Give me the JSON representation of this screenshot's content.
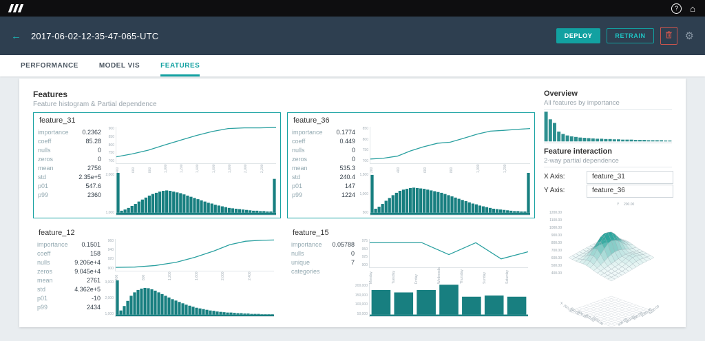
{
  "colors": {
    "accent": "#12a1a1",
    "hist": "#187f80",
    "line": "#2aa0a0",
    "navy": "#2e3f50",
    "topbar": "#0e0e10",
    "danger": "#c9544d"
  },
  "topbar": {
    "help_glyph": "?",
    "home_glyph": "⌂"
  },
  "navbar": {
    "back_glyph": "←",
    "title": "2017-06-02-12-35-47-065-UTC",
    "deploy": "DEPLOY",
    "retrain": "RETRAIN",
    "gear_glyph": "⚙"
  },
  "tabs": [
    {
      "label": "PERFORMANCE",
      "active": false
    },
    {
      "label": "MODEL VIS",
      "active": false
    },
    {
      "label": "FEATURES",
      "active": true
    }
  ],
  "features_section": {
    "title": "Features",
    "subtitle": "Feature histogram & Partial dependence",
    "panels": [
      {
        "name": "feature_31",
        "bordered": true,
        "type": "numeric",
        "stats": [
          {
            "label": "importance",
            "value": "0.2362"
          },
          {
            "label": "coeff",
            "value": "85.28"
          },
          {
            "label": "nulls",
            "value": "0"
          },
          {
            "label": "zeros",
            "value": "0"
          },
          {
            "label": "mean",
            "value": "2756"
          },
          {
            "label": "std",
            "value": "2.35e+5"
          },
          {
            "label": "p01",
            "value": "547.6"
          },
          {
            "label": "p99",
            "value": "2360"
          }
        ],
        "line": {
          "y_ticks": [
            "900",
            "850",
            "800",
            "750",
            "700"
          ],
          "points": [
            [
              0,
              0.18
            ],
            [
              0.1,
              0.26
            ],
            [
              0.2,
              0.36
            ],
            [
              0.3,
              0.5
            ],
            [
              0.4,
              0.63
            ],
            [
              0.5,
              0.76
            ],
            [
              0.6,
              0.87
            ],
            [
              0.7,
              0.95
            ],
            [
              0.8,
              0.97
            ],
            [
              0.9,
              0.97
            ],
            [
              1,
              0.98
            ]
          ]
        },
        "x_ticks": [
          "400",
          "600",
          "800",
          "1,000",
          "1,200",
          "1,400",
          "1,600",
          "1,800",
          "2,000",
          "2,200"
        ],
        "hist": {
          "y_ticks": [
            "2,000",
            "1,000"
          ],
          "values": [
            1,
            0.05,
            0.08,
            0.12,
            0.17,
            0.22,
            0.28,
            0.33,
            0.38,
            0.43,
            0.47,
            0.5,
            0.53,
            0.55,
            0.56,
            0.55,
            0.53,
            0.51,
            0.49,
            0.46,
            0.43,
            0.4,
            0.37,
            0.34,
            0.31,
            0.28,
            0.25,
            0.23,
            0.2,
            0.18,
            0.16,
            0.14,
            0.12,
            0.11,
            0.1,
            0.09,
            0.08,
            0.07,
            0.06,
            0.05,
            0.05,
            0.04,
            0.04,
            0.03,
            0.03,
            0.85
          ]
        }
      },
      {
        "name": "feature_36",
        "bordered": true,
        "type": "numeric",
        "stats": [
          {
            "label": "importance",
            "value": "0.1774"
          },
          {
            "label": "coeff",
            "value": "0.449"
          },
          {
            "label": "nulls",
            "value": "0"
          },
          {
            "label": "zeros",
            "value": "0"
          },
          {
            "label": "mean",
            "value": "535.3"
          },
          {
            "label": "std",
            "value": "240.4"
          },
          {
            "label": "p01",
            "value": "147"
          },
          {
            "label": "p99",
            "value": "1224"
          }
        ],
        "line": {
          "y_ticks": [
            "850",
            "800",
            "750",
            "700"
          ],
          "points": [
            [
              0,
              0.12
            ],
            [
              0.08,
              0.14
            ],
            [
              0.17,
              0.2
            ],
            [
              0.25,
              0.34
            ],
            [
              0.33,
              0.45
            ],
            [
              0.42,
              0.55
            ],
            [
              0.5,
              0.58
            ],
            [
              0.58,
              0.68
            ],
            [
              0.67,
              0.8
            ],
            [
              0.75,
              0.88
            ],
            [
              0.83,
              0.9
            ],
            [
              0.92,
              0.93
            ],
            [
              1,
              0.95
            ]
          ]
        },
        "x_ticks": [
          "200",
          "400",
          "600",
          "800",
          "1,000",
          "1,200"
        ],
        "hist": {
          "y_ticks": [
            "1,500",
            "1,000",
            "500"
          ],
          "values": [
            0.95,
            0.1,
            0.15,
            0.22,
            0.3,
            0.37,
            0.44,
            0.5,
            0.55,
            0.58,
            0.6,
            0.62,
            0.63,
            0.62,
            0.61,
            0.6,
            0.58,
            0.56,
            0.54,
            0.52,
            0.5,
            0.47,
            0.44,
            0.41,
            0.38,
            0.35,
            0.32,
            0.29,
            0.26,
            0.23,
            0.21,
            0.18,
            0.16,
            0.14,
            0.12,
            0.1,
            0.09,
            0.08,
            0.07,
            0.06,
            0.05,
            0.04,
            0.04,
            0.03,
            0.03,
            1
          ]
        }
      },
      {
        "name": "feature_12",
        "bordered": false,
        "type": "numeric",
        "stats": [
          {
            "label": "importance",
            "value": "0.1501"
          },
          {
            "label": "coeff",
            "value": "158"
          },
          {
            "label": "nulls",
            "value": "9.206e+4"
          },
          {
            "label": "zeros",
            "value": "9.045e+4"
          },
          {
            "label": "mean",
            "value": "2761"
          },
          {
            "label": "std",
            "value": "4.362e+5"
          },
          {
            "label": "p01",
            "value": "-10"
          },
          {
            "label": "p99",
            "value": "2434"
          }
        ],
        "line": {
          "y_ticks": [
            "960",
            "940",
            "920",
            "900"
          ],
          "points": [
            [
              0,
              0.1
            ],
            [
              0.12,
              0.11
            ],
            [
              0.25,
              0.16
            ],
            [
              0.38,
              0.26
            ],
            [
              0.5,
              0.42
            ],
            [
              0.62,
              0.62
            ],
            [
              0.72,
              0.82
            ],
            [
              0.82,
              0.93
            ],
            [
              0.91,
              0.96
            ],
            [
              1,
              0.97
            ]
          ]
        },
        "x_ticks": [
          "400",
          "800",
          "1,200",
          "1,600",
          "2,000",
          "2,400"
        ],
        "hist": {
          "y_ticks": [
            "3,000",
            "2,000",
            "1,000"
          ],
          "values": [
            1,
            0.12,
            0.25,
            0.4,
            0.55,
            0.65,
            0.72,
            0.76,
            0.78,
            0.77,
            0.74,
            0.7,
            0.65,
            0.6,
            0.55,
            0.5,
            0.45,
            0.41,
            0.37,
            0.33,
            0.29,
            0.26,
            0.23,
            0.2,
            0.18,
            0.16,
            0.14,
            0.12,
            0.11,
            0.09,
            0.08,
            0.07,
            0.06,
            0.06,
            0.05,
            0.04,
            0.04,
            0.03,
            0.03,
            0.02,
            0.02,
            0.02,
            0.01,
            0.01,
            0.01,
            0.01
          ]
        }
      },
      {
        "name": "feature_15",
        "bordered": false,
        "type": "categorical",
        "stats": [
          {
            "label": "importance",
            "value": "0.05788"
          },
          {
            "label": "nulls",
            "value": "0"
          },
          {
            "label": "unique",
            "value": "7"
          },
          {
            "label": "categories",
            "value": ""
          }
        ],
        "line": {
          "y_ticks": [
            "975",
            "950",
            "925",
            "900"
          ],
          "points": [
            [
              0,
              0.87
            ],
            [
              0.17,
              0.87
            ],
            [
              0.33,
              0.87
            ],
            [
              0.5,
              0.45
            ],
            [
              0.67,
              0.87
            ],
            [
              0.83,
              0.3
            ],
            [
              1,
              0.55
            ]
          ]
        },
        "x_ticks": [
          "Monday",
          "Tuesday",
          "Friday",
          "Wednesday",
          "Thursday",
          "Sunday",
          "Saturday"
        ],
        "hist": {
          "y_ticks": [
            "200,000",
            "150,000",
            "100,000",
            "50,000"
          ],
          "values": [
            0.8,
            0.72,
            0.8,
            0.97,
            0.58,
            0.62,
            0.58
          ]
        }
      }
    ]
  },
  "overview": {
    "title": "Overview",
    "subtitle": "All features by importance",
    "values": [
      1,
      0.74,
      0.62,
      0.33,
      0.25,
      0.2,
      0.17,
      0.15,
      0.13,
      0.12,
      0.11,
      0.1,
      0.09,
      0.09,
      0.08,
      0.08,
      0.07,
      0.07,
      0.06,
      0.06,
      0.06,
      0.05,
      0.05,
      0.05,
      0.04,
      0.04,
      0.04,
      0.04,
      0.03,
      0.03
    ]
  },
  "interaction": {
    "title": "Feature interaction",
    "subtitle": "2-way partial dependence",
    "x_label": "X Axis:",
    "y_label": "Y Axis:",
    "x_value": "feature_31",
    "y_value": "feature_36"
  },
  "plot3d": {
    "x_axis_label": "X",
    "y_axis_label": "Y",
    "top_tick": "200.00",
    "z_ticks": [
      "1200.00",
      "1100.00",
      "1000.00",
      "900.00",
      "800.00",
      "700.00",
      "600.00",
      "500.00",
      "400.00"
    ],
    "x_ticks": [
      "200.00",
      "400.00",
      "600.00",
      "800.00",
      "1000.00"
    ],
    "y_ticks": [
      "400.00",
      "600.00",
      "800.00",
      "1000.00",
      "1200.00"
    ]
  }
}
